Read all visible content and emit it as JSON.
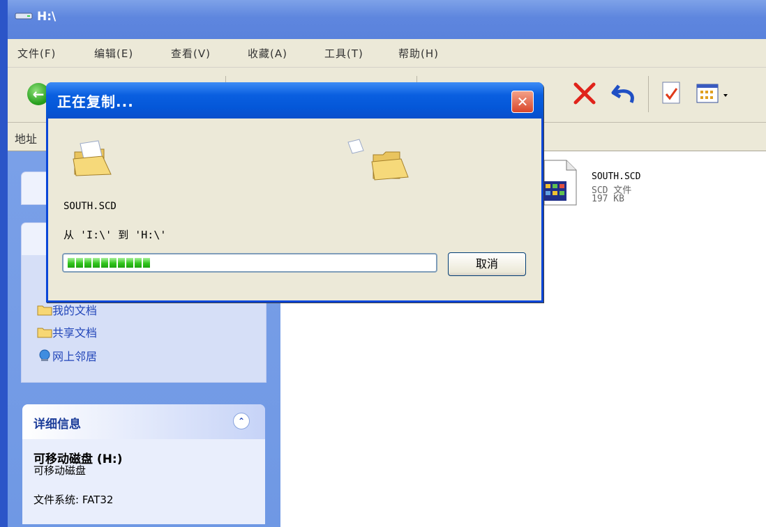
{
  "window": {
    "title": "H:\\"
  },
  "menu": [
    {
      "label": "文件(F)"
    },
    {
      "label": "编辑(E)"
    },
    {
      "label": "查看(V)"
    },
    {
      "label": "收藏(A)"
    },
    {
      "label": "工具(T)"
    },
    {
      "label": "帮助(H)"
    }
  ],
  "addressbar": {
    "label": "地址"
  },
  "taskpane": {
    "other_places": [
      {
        "label": "我的文档"
      },
      {
        "label": "共享文档"
      },
      {
        "label": "网上邻居"
      }
    ],
    "details": {
      "title": "详细信息",
      "drive_name": "可移动磁盘 (H:)",
      "drive_type": "可移动磁盘",
      "filesystem": "文件系统: FAT32"
    }
  },
  "file": {
    "name": "SOUTH.SCD",
    "type": "SCD 文件",
    "size": "197 KB"
  },
  "dialog": {
    "title": "正在复制...",
    "filename": "SOUTH.SCD",
    "path_text": "从 'I:\\' 到 'H:\\'",
    "progress_blocks": 10,
    "cancel_label": "取消"
  }
}
